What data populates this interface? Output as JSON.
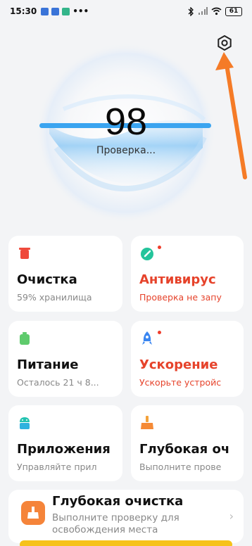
{
  "status_bar": {
    "time": "15:30",
    "dots": "•••",
    "battery": "61"
  },
  "scan": {
    "score": "98",
    "status": "Проверка..."
  },
  "cards": [
    {
      "title": "Очистка",
      "subtitle": "59% хранилища"
    },
    {
      "title": "Антивирус",
      "subtitle": "Проверка не запу"
    },
    {
      "title": "Питание",
      "subtitle": "Осталось 21 ч 8..."
    },
    {
      "title": "Ускорение",
      "subtitle": "Ускорьте устройс"
    },
    {
      "title": "Приложения",
      "subtitle": "Управляйте прил"
    },
    {
      "title": "Глубокая оч",
      "subtitle": "Выполните прове"
    }
  ],
  "banner": {
    "title": "Глубокая очистка",
    "subtitle": "Выполните проверку для освобождения места"
  },
  "colors": {
    "accent_red": "#e6432b",
    "arrow_orange": "#f57b27",
    "scan_blue": "#3aa4f0",
    "banner_yellow": "#f6c21a"
  }
}
